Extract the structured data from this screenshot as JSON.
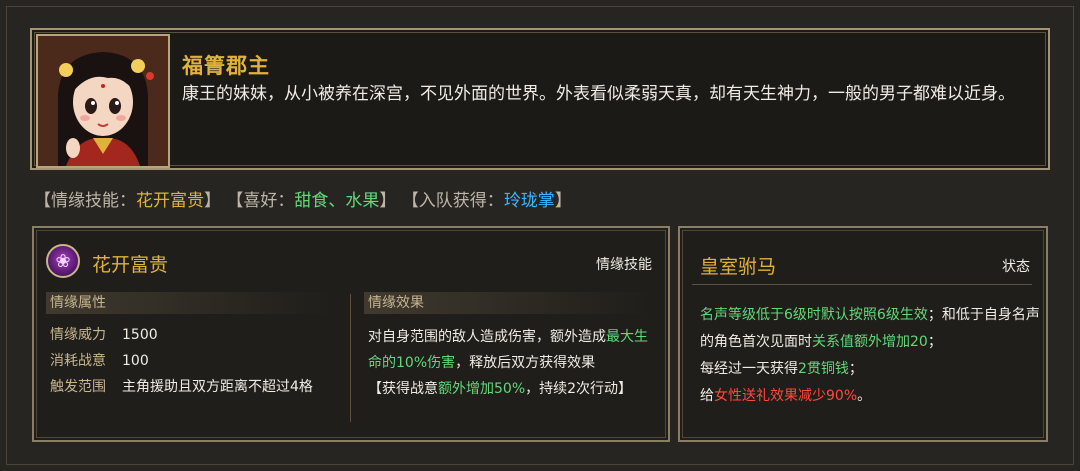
{
  "character": {
    "name": "福箐郡主",
    "description": "康王的妹妹，从小被养在深宫，不见外面的世界。外表看似柔弱天真，却有天生神力，一般的男子都难以近身。",
    "portrait_icon": "princess-portrait"
  },
  "tags": {
    "skill_label": "【情缘技能：",
    "skill_value": "花开富贵",
    "skill_close": "】",
    "hobby_label": "【喜好：",
    "hobby_value": "甜食、水果",
    "hobby_close": "】",
    "join_label": "【入队获得：",
    "join_value": "玲珑掌",
    "join_close": "】"
  },
  "skill_panel": {
    "icon": "lotus-skill-icon",
    "title": "花开富贵",
    "kind": "情缘技能",
    "attributes_header": "情缘属性",
    "attributes": [
      {
        "key": "情缘威力",
        "value": "1500"
      },
      {
        "key": "消耗战意",
        "value": "100"
      },
      {
        "key": "触发范围",
        "value": "主角援助且双方距离不超过4格"
      }
    ],
    "effect_header": "情缘效果",
    "effect": {
      "p1": "对自身范围的敌人造成伤害，额外造成",
      "p1_green": "最大生命的10%伤害",
      "p2": "，释放后双方获得效果",
      "p3_open": "【获得战意",
      "p3_green": "额外增加50%",
      "p3_close": "，持续2次行动】"
    }
  },
  "status_panel": {
    "title": "皇室驸马",
    "kind": "状态",
    "line1_green": "名声等级低于6级时默认按照6级生效",
    "line1_rest": "；和低于自身名声的角色首次见面时",
    "line1_green2": "关系值额外增加20",
    "line1_end": "；",
    "line2_a": "每经过一天获得",
    "line2_green": "2贯铜钱",
    "line2_end": "；",
    "line3_a": "给",
    "line3_red": "女性送礼效果减少90%",
    "line3_end": "。"
  },
  "colors": {
    "gold": "#e0b13c",
    "green": "#63d87a",
    "blue": "#3cb6ff",
    "red": "#ff4a3c",
    "background": "#272521"
  }
}
